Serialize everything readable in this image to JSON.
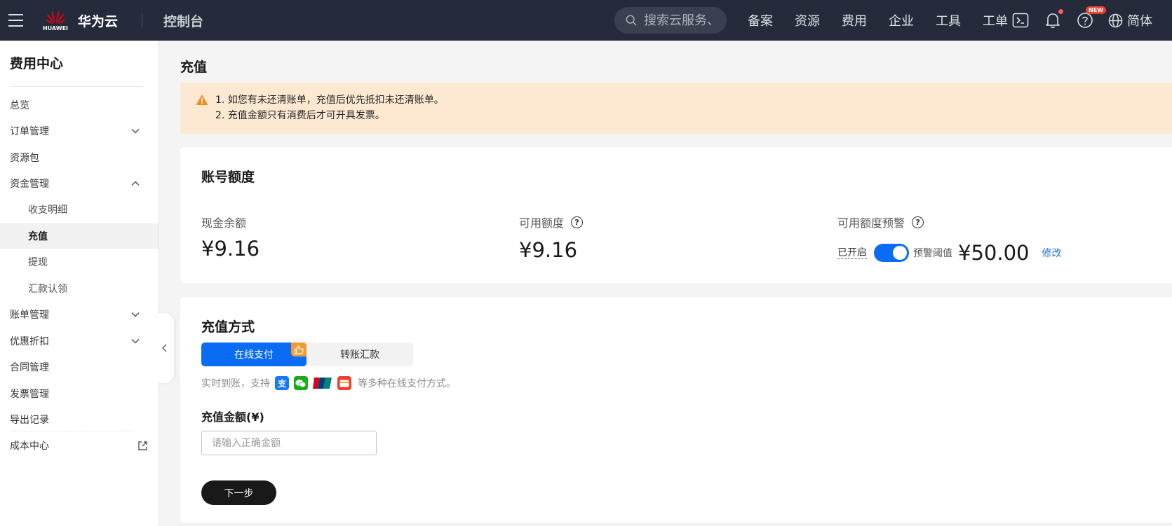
{
  "topbar": {
    "brand_logo_text": "HUAWEI",
    "brand_name": "华为云",
    "console_title": "控制台",
    "search_placeholder": "搜索云服务、",
    "nav": [
      "备案",
      "资源",
      "费用",
      "企业",
      "工具",
      "工单"
    ],
    "new_badge": "NEW",
    "language": "简体",
    "icons": [
      "menu-icon",
      "search-icon",
      "terminal-icon",
      "bell-icon",
      "help-icon",
      "globe-icon"
    ]
  },
  "sidebar": {
    "title": "费用中心",
    "items": [
      {
        "label": "总览"
      },
      {
        "label": "订单管理"
      },
      {
        "label": "资源包"
      },
      {
        "label": "资金管理"
      },
      {
        "label": "收支明细"
      },
      {
        "label": "充值"
      },
      {
        "label": "提现"
      },
      {
        "label": "汇款认领"
      },
      {
        "label": "账单管理"
      },
      {
        "label": "优惠折扣"
      },
      {
        "label": "合同管理"
      },
      {
        "label": "发票管理"
      },
      {
        "label": "导出记录"
      },
      {
        "label": "成本中心"
      }
    ]
  },
  "page": {
    "title": "充值",
    "notice": [
      "1. 如您有未还清账单，充值后优先抵扣未还清账单。",
      "2. 充值金额只有消费后才可开具发票。"
    ]
  },
  "account_quota": {
    "title": "账号额度",
    "cash_balance_label": "现金余额",
    "cash_balance_value": "¥9.16",
    "available_quota_label": "可用额度",
    "available_quota_value": "¥9.16",
    "quota_alert_label": "可用额度预警",
    "alert_status": "已开启",
    "alert_enabled": true,
    "alert_threshold_label": "预警阈值",
    "alert_threshold_value": "¥50.00",
    "edit_label": "修改"
  },
  "recharge": {
    "title": "充值方式",
    "tabs": [
      "在线支付",
      "转账汇款"
    ],
    "active_tab": 0,
    "desc_prefix": "实时到账，支持",
    "desc_suffix": "等多种在线支付方式。",
    "pay_methods": [
      "支",
      "",
      "",
      ""
    ],
    "amount_label": "充值金额(¥)",
    "amount_placeholder": "请输入正确金额",
    "amount_value": "",
    "next_button": "下一步"
  },
  "colors": {
    "topbar_bg": "#252b3a",
    "accent_blue": "#0a6cf5",
    "notice_bg": "#fde9d2",
    "warning_orange": "#f28c1f",
    "link_blue": "#1f6feb"
  }
}
